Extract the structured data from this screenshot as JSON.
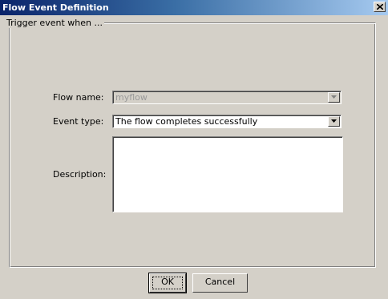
{
  "window": {
    "title": "Flow Event Definition",
    "close_icon": "close-icon"
  },
  "group": {
    "legend": "Trigger event when ..."
  },
  "form": {
    "flow_name_label": "Flow name:",
    "flow_name_value": "myflow",
    "event_type_label": "Event type:",
    "event_type_value": "The flow completes successfully",
    "description_label": "Description:",
    "description_value": ""
  },
  "buttons": {
    "ok": "OK",
    "cancel": "Cancel"
  },
  "colors": {
    "dialog_bg": "#d4d0c8",
    "titlebar_start": "#0a246a",
    "titlebar_end": "#a6caf0"
  }
}
